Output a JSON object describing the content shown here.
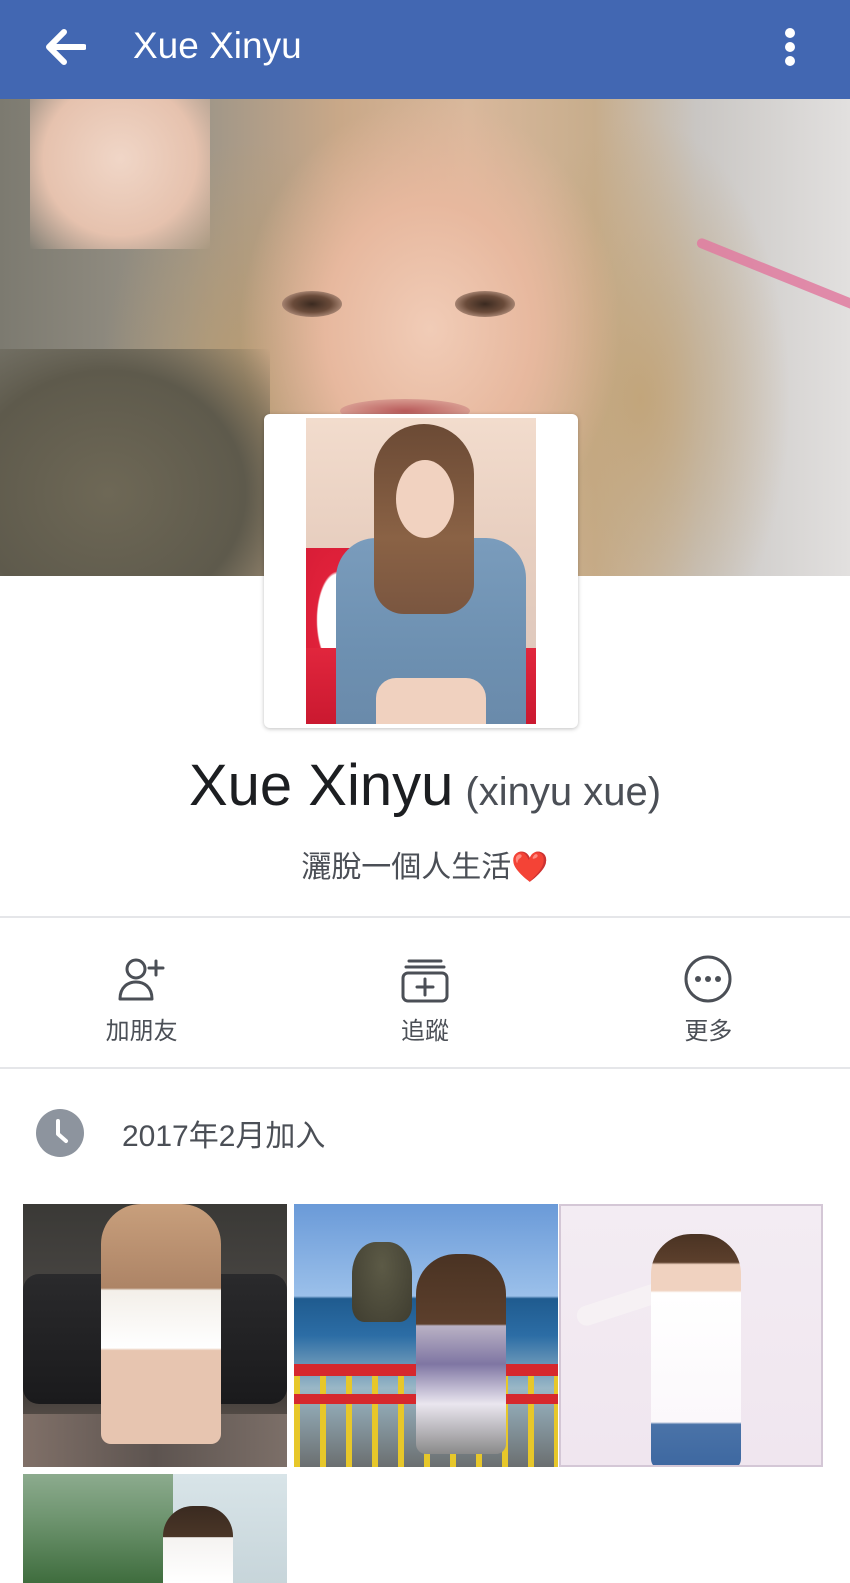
{
  "header": {
    "title": "Xue Xinyu",
    "back_icon": "arrow-left-icon",
    "menu_icon": "more-vertical-icon",
    "bar_color": "#4267b2"
  },
  "profile": {
    "name": "Xue Xinyu",
    "alternate_name": "(xinyu xue)",
    "bio_text": "灑脫一個人生活",
    "bio_emoji": "❤️"
  },
  "actions": [
    {
      "label": "加朋友",
      "icon": "add-friend-icon"
    },
    {
      "label": "追蹤",
      "icon": "follow-icon"
    },
    {
      "label": "更多",
      "icon": "more-horizontal-icon"
    }
  ],
  "intro": {
    "joined_text": "2017年2月加入",
    "joined_icon": "clock-icon"
  },
  "photos": [
    {
      "kind": "photo",
      "subject": "girl-on-sofa"
    },
    {
      "kind": "photo",
      "subject": "girl-by-sea"
    },
    {
      "kind": "photo",
      "subject": "girl-white-top"
    },
    {
      "kind": "photo",
      "subject": "girl-on-cliff"
    }
  ]
}
